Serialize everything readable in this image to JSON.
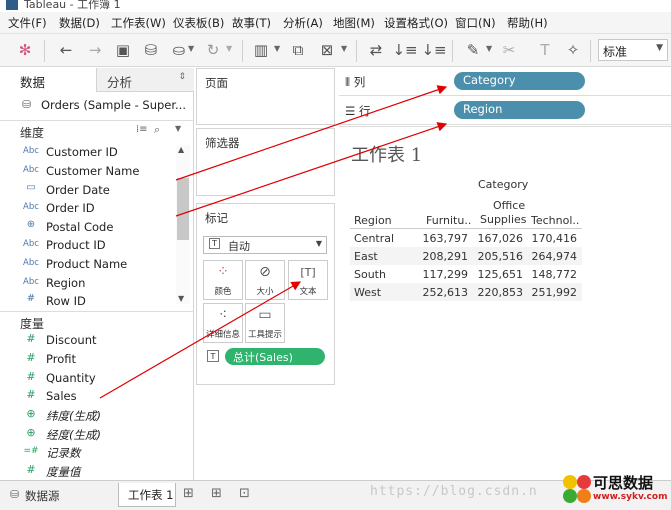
{
  "app": {
    "title": "Tableau - 工作簿 1"
  },
  "menu": [
    "文件(F)",
    "数据(D)",
    "工作表(W)",
    "仪表板(B)",
    "故事(T)",
    "分析(A)",
    "地图(M)",
    "设置格式(O)",
    "窗口(N)",
    "帮助(H)"
  ],
  "toolbar": {
    "fit_value": "标准"
  },
  "datapane": {
    "tab_data": "数据",
    "tab_analysis": "分析",
    "datasource": "Orders (Sample - Super...",
    "dimensions_title": "维度",
    "dimensions": [
      {
        "label": "Customer ID",
        "type": "Abc"
      },
      {
        "label": "Customer Name",
        "type": "Abc"
      },
      {
        "label": "Order Date",
        "type": "date"
      },
      {
        "label": "Order ID",
        "type": "Abc"
      },
      {
        "label": "Postal Code",
        "type": "geo"
      },
      {
        "label": "Product ID",
        "type": "Abc"
      },
      {
        "label": "Product Name",
        "type": "Abc"
      },
      {
        "label": "Region",
        "type": "Abc"
      },
      {
        "label": "Row ID",
        "type": "#"
      }
    ],
    "measures_title": "度量",
    "measures": [
      {
        "label": "Discount",
        "type": "#"
      },
      {
        "label": "Profit",
        "type": "#"
      },
      {
        "label": "Quantity",
        "type": "#"
      },
      {
        "label": "Sales",
        "type": "#"
      },
      {
        "label": "纬度(生成)",
        "type": "geo"
      },
      {
        "label": "经度(生成)",
        "type": "geo"
      },
      {
        "label": "记录数",
        "type": "=#"
      },
      {
        "label": "度量值",
        "type": "#"
      }
    ]
  },
  "shelves": {
    "pages": "页面",
    "filters": "筛选器",
    "marks": "标记",
    "marks_type": "自动",
    "mark_buttons": [
      "颜色",
      "大小",
      "文本",
      "详细信息",
      "工具提示"
    ],
    "marks_pill": "总计(Sales)",
    "columns_label": "列",
    "columns_pill": "Category",
    "rows_label": "行",
    "rows_pill": "Region"
  },
  "worksheet": {
    "title": "工作表 1",
    "category_header": "Category",
    "row_header": "Region",
    "col_headers": [
      [
        "Furnitu.."
      ],
      [
        "Office",
        "Supplies"
      ],
      [
        "Technol.."
      ]
    ],
    "rows": [
      {
        "region": "Central",
        "values": [
          "163,797",
          "167,026",
          "170,416"
        ]
      },
      {
        "region": "East",
        "values": [
          "208,291",
          "205,516",
          "264,974"
        ]
      },
      {
        "region": "South",
        "values": [
          "117,299",
          "125,651",
          "148,772"
        ]
      },
      {
        "region": "West",
        "values": [
          "252,613",
          "220,853",
          "251,992"
        ]
      }
    ]
  },
  "bottombar": {
    "datasource_tab": "数据源",
    "sheet_tab": "工作表 1"
  },
  "watermark": "https://blog.csdn.n",
  "logo": {
    "text": "可思数据",
    "url": "www.sykv.com"
  },
  "colors": {
    "pill_blue": "#4c8fac",
    "pill_green": "#2fb36d",
    "annotation": "#e00000"
  }
}
